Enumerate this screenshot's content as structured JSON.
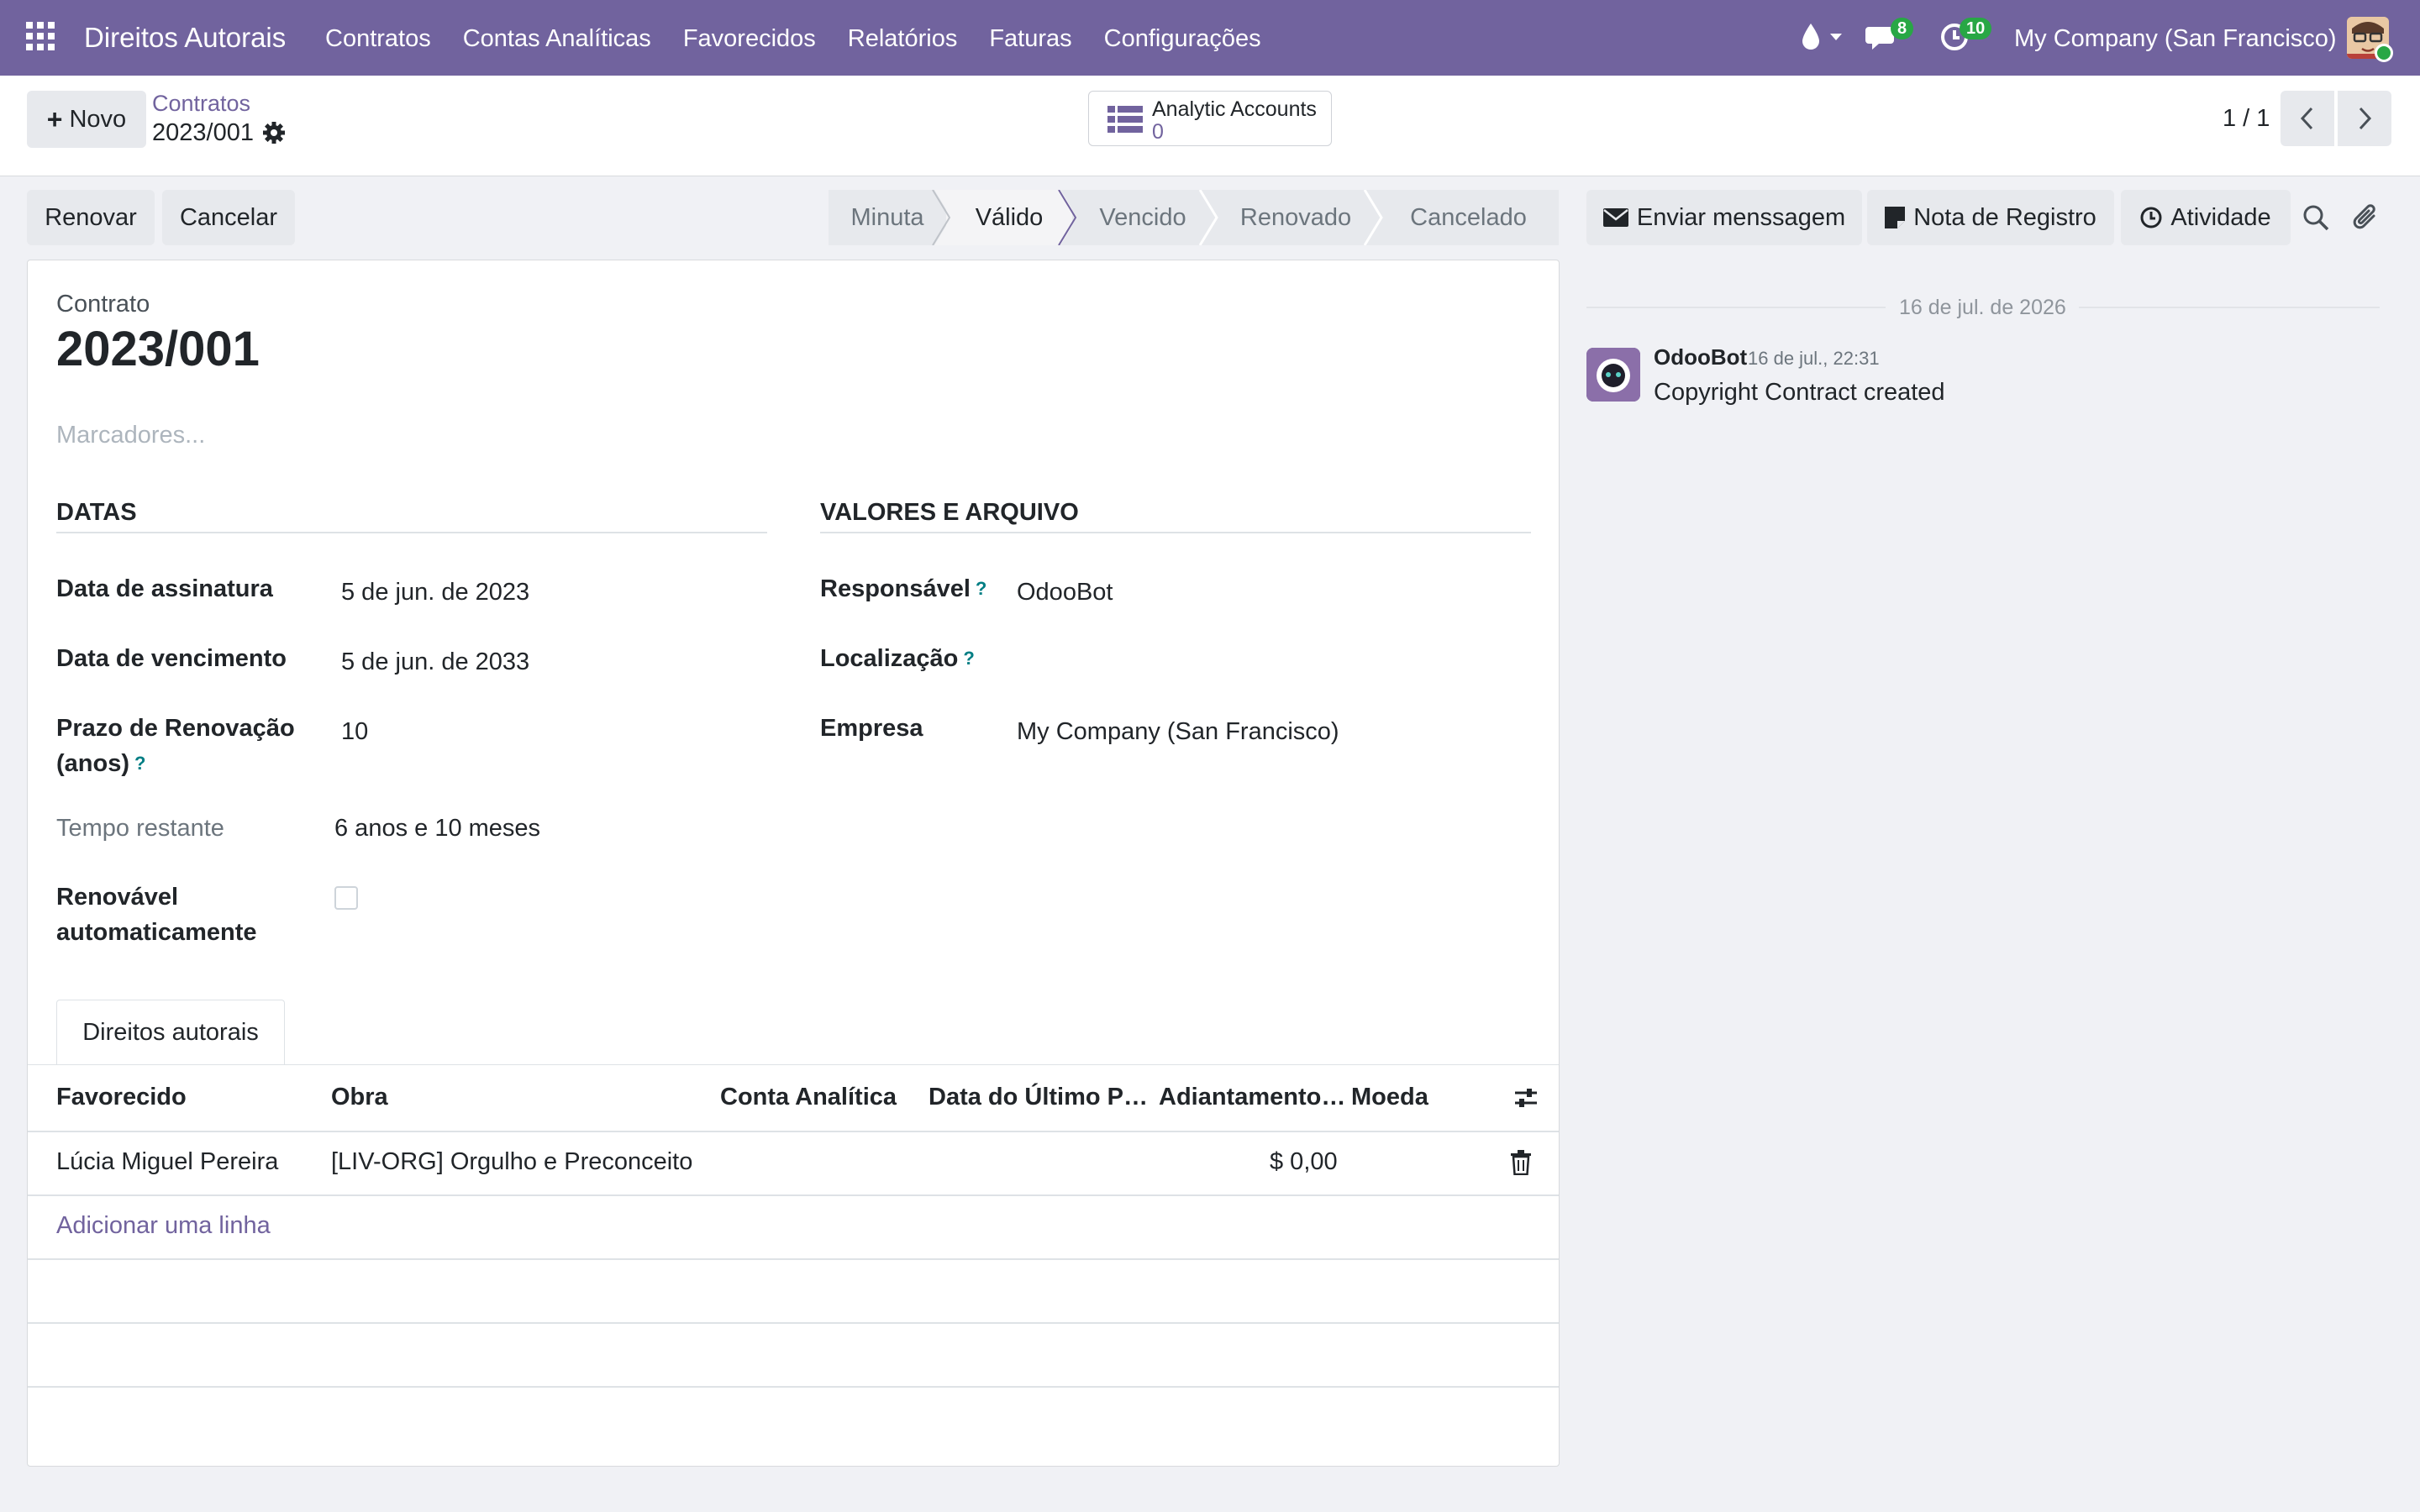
{
  "navbar": {
    "app_name": "Direitos Autorais",
    "menu": [
      "Contratos",
      "Contas Analíticas",
      "Favorecidos",
      "Relatórios",
      "Faturas",
      "Configurações"
    ],
    "messages_badge": "8",
    "activities_badge": "10",
    "company": "My Company (San Francisco)"
  },
  "control": {
    "new_label": "Novo",
    "breadcrumb_parent": "Contratos",
    "breadcrumb_current": "2023/001",
    "smart_button_label": "Analytic Accounts",
    "smart_button_count": "0",
    "pager": "1 / 1"
  },
  "actions": {
    "renew": "Renovar",
    "cancel": "Cancelar"
  },
  "statusbar": {
    "stages": [
      "Minuta",
      "Válido",
      "Vencido",
      "Renovado",
      "Cancelado"
    ],
    "active": "Válido"
  },
  "form": {
    "record_label": "Contrato",
    "record_name": "2023/001",
    "tags_placeholder": "Marcadores...",
    "group_dates": "DATAS",
    "group_values": "VALORES E ARQUIVO",
    "signature_label": "Data de assinatura",
    "signature_value": "5 de jun. de 2023",
    "expiry_label": "Data de vencimento",
    "expiry_value": "5 de jun. de 2033",
    "renewal_label_1": "Prazo de Renovação",
    "renewal_label_2": "(anos)",
    "renewal_value": "10",
    "remaining_label": "Tempo restante",
    "remaining_value": "6 anos e 10 meses",
    "auto_renew_label_1": "Renovável",
    "auto_renew_label_2": "automaticamente",
    "auto_renew_checked": false,
    "responsible_label": "Responsável",
    "responsible_value": "OdooBot",
    "location_label": "Localização",
    "location_value": "",
    "company_label": "Empresa",
    "company_value": "My Company (San Francisco)",
    "help_mark": "?"
  },
  "tabs": [
    "Direitos autorais"
  ],
  "lines_table": {
    "columns": [
      "Favorecido",
      "Obra",
      "Conta Analítica",
      "Data do Último P…",
      "Adiantamento…",
      "Moeda"
    ],
    "rows": [
      {
        "favorecido": "Lúcia Miguel Pereira",
        "obra": "[LIV-ORG] Orgulho e Preconceito",
        "conta": "",
        "data": "",
        "adiantamento": "$ 0,00",
        "moeda": ""
      }
    ],
    "add_line": "Adicionar uma linha"
  },
  "chatter": {
    "send_message": "Enviar menssagem",
    "log_note": "Nota de Registro",
    "activity": "Atividade",
    "date_separator": "16 de jul. de 2026",
    "messages": [
      {
        "author": "OdooBot",
        "date": "16 de jul., 22:31",
        "body": "Copyright Contract created"
      }
    ]
  },
  "colors": {
    "brand": "#71639e",
    "badge": "#28a745",
    "help": "#017e84"
  }
}
